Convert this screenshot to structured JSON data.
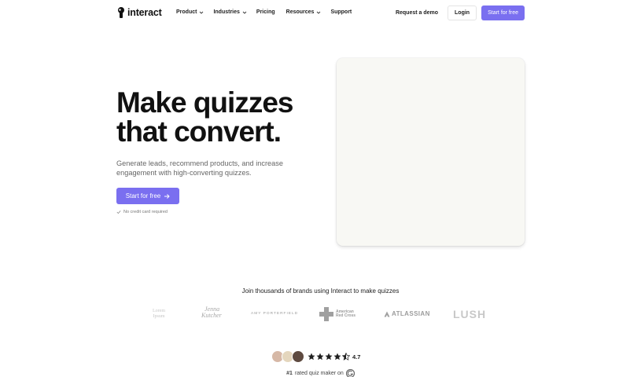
{
  "brand": {
    "logo_text": "interact",
    "accent_color": "#7a6ff0"
  },
  "nav": {
    "items": [
      {
        "label": "Product",
        "has_dropdown": true
      },
      {
        "label": "Industries",
        "has_dropdown": true
      },
      {
        "label": "Pricing",
        "has_dropdown": false
      },
      {
        "label": "Resources",
        "has_dropdown": true
      },
      {
        "label": "Support",
        "has_dropdown": false
      }
    ],
    "request_demo": "Request a demo",
    "login": "Login",
    "start_free": "Start for free"
  },
  "hero": {
    "title_line1": "Make quizzes",
    "title_line2": "that convert.",
    "subtitle": "Generate leads, recommend products, and increase engagement with high-converting quizzes.",
    "cta_label": "Start for free",
    "cta_icon": "arrow-right-icon",
    "no_card_note": "No credit card required",
    "no_card_icon": "check-icon"
  },
  "brands": {
    "heading": "Join thousands of brands using Interact to make quizzes",
    "logos": [
      {
        "name": "brand-logo-1",
        "line1": "Lorem",
        "line2": "Ipsum"
      },
      {
        "name": "jenna-kutcher-logo",
        "line1": "Jenna",
        "line2": "Kutcher"
      },
      {
        "name": "amy-porterfield-logo",
        "text": "AMY PORTERFIELD"
      },
      {
        "name": "american-red-cross-logo",
        "line1": "American",
        "line2": "Red Cross"
      },
      {
        "name": "atlassian-logo",
        "text": "ATLASSIAN"
      },
      {
        "name": "lush-logo",
        "text": "LUSH"
      }
    ]
  },
  "rating": {
    "value": "4.7",
    "stars": 4.5,
    "rated_prefix": "#1",
    "rated_text": "rated quiz maker on",
    "platform_icon": "g2-icon"
  }
}
